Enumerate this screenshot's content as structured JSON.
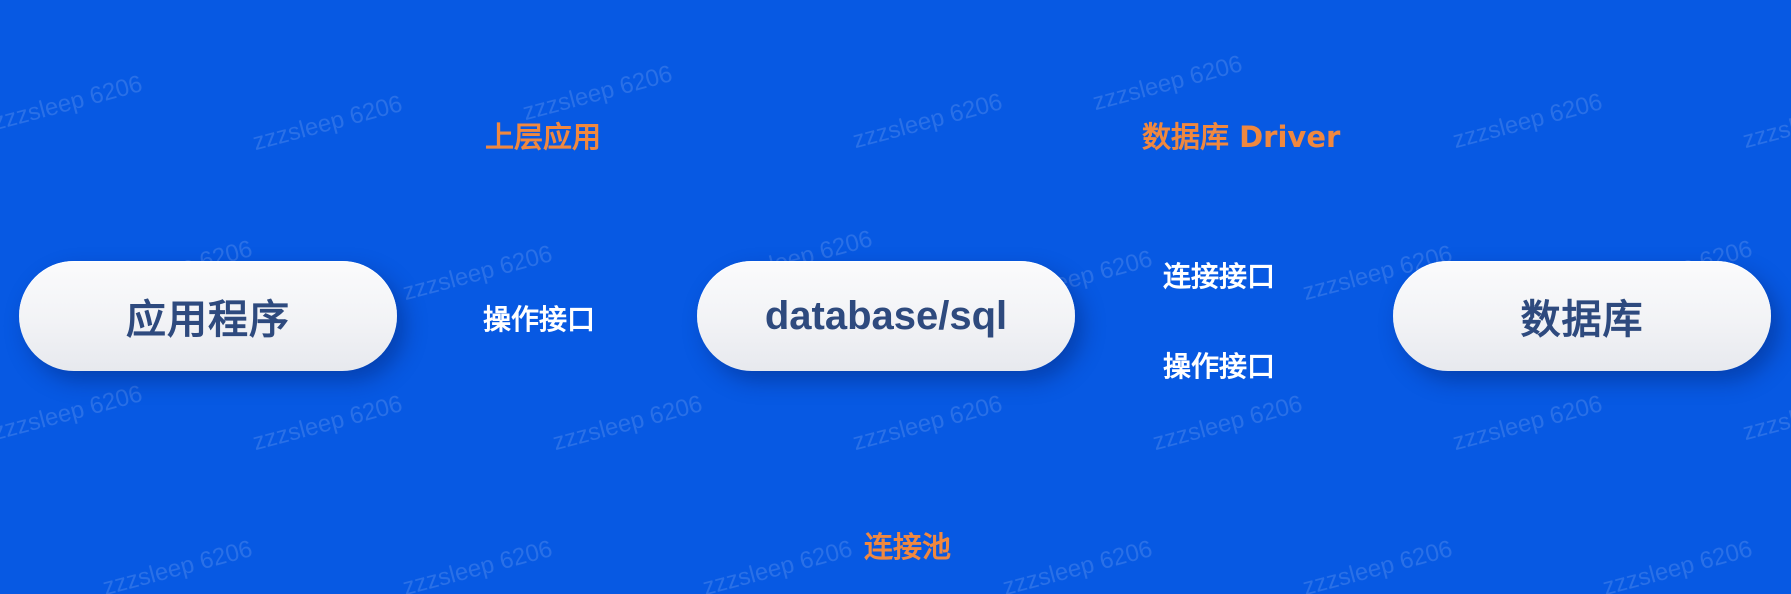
{
  "diagram": {
    "nodes": {
      "app": "应用程序",
      "sql": "database/sql",
      "db": "数据库"
    },
    "labels": {
      "upper_app": "上层应用",
      "db_driver": "数据库 Driver",
      "op_interface_left": "操作接口",
      "conn_interface": "连接接口",
      "op_interface_right": "操作接口",
      "conn_pool": "连接池"
    }
  },
  "watermark": "zzzsleep 6206",
  "colors": {
    "background": "#0759e3",
    "accent_orange": "#f0883f",
    "node_text": "#2e4a7e",
    "node_fill": "#f2f3f6"
  }
}
